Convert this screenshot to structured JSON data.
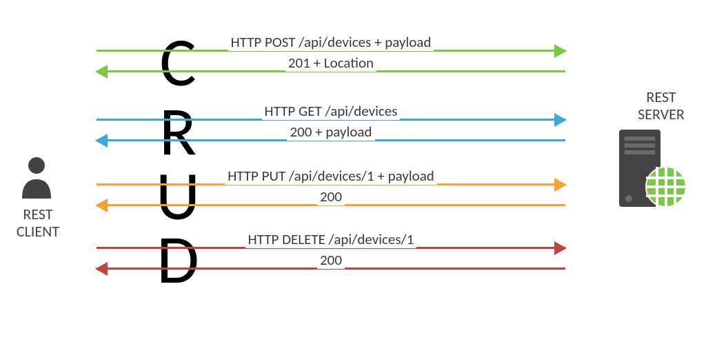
{
  "client": {
    "label_line1": "REST",
    "label_line2": "CLIENT"
  },
  "server": {
    "label_line1": "REST",
    "label_line2": "SERVER"
  },
  "crud": {
    "c": "C",
    "r": "R",
    "u": "U",
    "d": "D"
  },
  "rows": {
    "create": {
      "request": "HTTP POST /api/devices + payload",
      "response": "201 + Location",
      "color": "#7ac943"
    },
    "read": {
      "request": "HTTP GET /api/devices",
      "response": "200 + payload",
      "color": "#3ea9d6"
    },
    "update": {
      "request": "HTTP PUT /api/devices/1 + payload",
      "response": "200",
      "color": "#f6a13a"
    },
    "delete": {
      "request": "HTTP DELETE /api/devices/1",
      "response": "200",
      "color": "#c2443f"
    }
  }
}
